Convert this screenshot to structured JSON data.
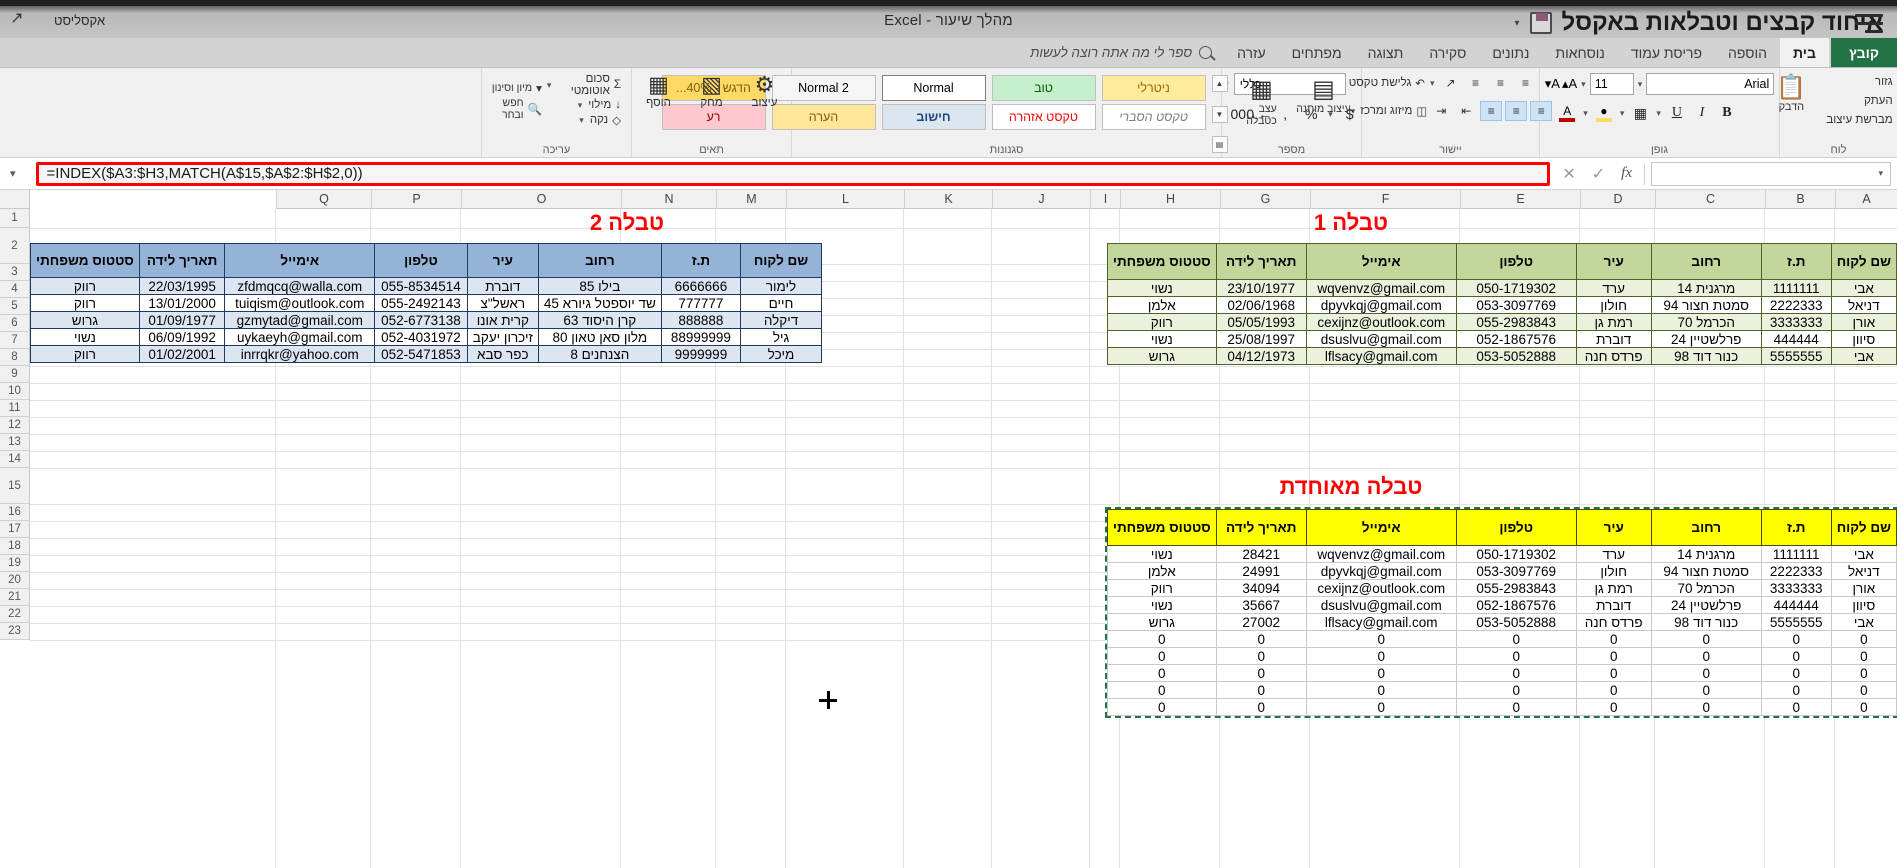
{
  "window": {
    "title": "מהלך שיעור  -  Excel",
    "account_name": "אקסליסט",
    "quick_access": [
      "save-icon",
      "undo-icon",
      "customize-icon"
    ],
    "doc_label": "איחוד קבצים וטבלאות באקסל"
  },
  "ribbon": {
    "file_tab": "קובץ",
    "tabs": [
      {
        "label": "בית",
        "active": true
      },
      {
        "label": "הוספה",
        "active": false
      },
      {
        "label": "פריסת עמוד",
        "active": false
      },
      {
        "label": "נוסחאות",
        "active": false
      },
      {
        "label": "נתונים",
        "active": false
      },
      {
        "label": "סקירה",
        "active": false
      },
      {
        "label": "תצוגה",
        "active": false
      },
      {
        "label": "מפתחים",
        "active": false
      },
      {
        "label": "עזרה",
        "active": false
      }
    ],
    "tell_me": "ספר לי מה אתה רוצה לעשות",
    "groups": {
      "clipboard": {
        "label": "לוח",
        "paste": "הדבק",
        "cut": "גזור",
        "copy": "העתק",
        "format_painter": "מברשת עיצוב"
      },
      "font": {
        "label": "גופן",
        "font_name": "Arial",
        "font_size": "11",
        "grow": "A",
        "shrink": "A",
        "bold": "B",
        "italic": "I",
        "underline": "U"
      },
      "alignment": {
        "label": "יישור",
        "wrap_text": "גלישת טקסט",
        "merge_center": "מיזוג ומרכז"
      },
      "number": {
        "label": "מספר",
        "format": "כללי",
        "percent": "%",
        "comma": ",",
        "currency": "$"
      },
      "styles": {
        "label": "סגנונות",
        "conditional_formatting": "עיצוב מותנה",
        "format_as_table": "עיצוב כטבלה",
        "cell_styles": "עצב",
        "cell_styles_sub": "כטבלה",
        "gallery": [
          {
            "name": "Normal",
            "key": "normal"
          },
          {
            "name": "Normal 2",
            "key": "normal2"
          },
          {
            "name": "הדגש - 40%...",
            "key": "accent40"
          },
          {
            "name": "טוב",
            "key": "good"
          },
          {
            "name": "ניטרלי",
            "key": "neutral"
          },
          {
            "name": "רע",
            "key": "bad"
          },
          {
            "name": "הערה",
            "key": "note"
          },
          {
            "name": "חישוב",
            "key": "calc"
          },
          {
            "name": "טקסט אזהרה",
            "key": "warning"
          },
          {
            "name": "טקסט הסברי",
            "key": "explanatory"
          }
        ]
      },
      "cells": {
        "label": "תאים",
        "insert": "הוסף",
        "delete": "מחק",
        "format": "עיצוב"
      },
      "editing": {
        "label": "עריכה",
        "autosum": "סכום אוטומטי",
        "fill": "מילוי",
        "clear": "נקה",
        "sort_filter": "מיון וסינון",
        "find_select": "חפש ובחר"
      }
    }
  },
  "formula_bar": {
    "name_box": "",
    "cancel_icon": "close-icon",
    "confirm_icon": "check-icon",
    "function_icon": "fx-icon",
    "formula": "=INDEX($A3:$H3,MATCH(A$15,$A$2:$H$2,0))",
    "expand_icon": "chevron-down-icon"
  },
  "grid": {
    "column_headers": [
      "A",
      "B",
      "C",
      "D",
      "E",
      "F",
      "G",
      "H",
      "I",
      "J",
      "K",
      "L",
      "M",
      "N",
      "O",
      "P",
      "Q"
    ],
    "row_headers": [
      "1",
      "2",
      "3",
      "4",
      "5",
      "6",
      "7",
      "8",
      "9",
      "10",
      "11",
      "12",
      "13",
      "14",
      "15",
      "16",
      "17",
      "18",
      "19",
      "20",
      "21",
      "22",
      "23"
    ]
  },
  "tables": {
    "table1": {
      "title": "טבלה 1",
      "headers": [
        "שם לקוח",
        "ת.ז",
        "רחוב",
        "עיר",
        "טלפון",
        "אימייל",
        "תאריך לידה",
        "סטטוס משפחתי"
      ],
      "rows": [
        [
          "אבי",
          "1111111",
          "מרגנית 14",
          "ערד",
          "050-1719302",
          "wqvenvz@gmail.com",
          "23/10/1977",
          "נשוי"
        ],
        [
          "דניאל",
          "2222333",
          "סמטת חצור 94",
          "חולון",
          "053-3097769",
          "dpyvkqj@gmail.com",
          "02/06/1968",
          "אלמן"
        ],
        [
          "אורן",
          "3333333",
          "הכרמל 70",
          "רמת גן",
          "055-2983843",
          "cexijnz@outlook.com",
          "05/05/1993",
          "רווק"
        ],
        [
          "סיוון",
          "444444",
          "פרלשטיין 24",
          "דוברת",
          "052-1867576",
          "dsuslvu@gmail.com",
          "25/08/1997",
          "נשוי"
        ],
        [
          "אבי",
          "5555555",
          "כנור דוד 98",
          "פרדס חנה",
          "053-5052888",
          "lflsacy@gmail.com",
          "04/12/1973",
          "גרוש"
        ]
      ]
    },
    "table2": {
      "title": "טבלה 2",
      "headers": [
        "שם לקוח",
        "ת.ז",
        "רחוב",
        "עיר",
        "טלפון",
        "אימייל",
        "תאריך לידה",
        "סטטוס משפחתי"
      ],
      "rows": [
        [
          "לימור",
          "6666666",
          "בילו 85",
          "דוברת",
          "055-8534514",
          "zfdmqcq@walla.com",
          "22/03/1995",
          "רווק"
        ],
        [
          "חיים",
          "777777",
          "שד יוספטל גיורא 45",
          "ראשל\"צ",
          "055-2492143",
          "tuiqism@outlook.com",
          "13/01/2000",
          "רווק"
        ],
        [
          "דיקלה",
          "888888",
          "קרן היסוד 63",
          "קרית אונו",
          "052-6773138",
          "gzmytad@gmail.com",
          "01/09/1977",
          "גרוש"
        ],
        [
          "גיל",
          "88999999",
          "מלון סאן טאון 80",
          "זיכרון יעקב",
          "052-4031972",
          "uykaeyh@gmail.com",
          "06/09/1992",
          "נשוי"
        ],
        [
          "מיכל",
          "9999999",
          "הצנחנים 8",
          "כפר סבא",
          "052-5471853",
          "inrrqkr@yahoo.com",
          "01/02/2001",
          "רווק"
        ]
      ]
    },
    "merged": {
      "title": "טבלה מאוחדת",
      "headers": [
        "שם לקוח",
        "ת.ז",
        "רחוב",
        "עיר",
        "טלפון",
        "אימייל",
        "תאריך לידה",
        "סטטוס משפחתי"
      ],
      "rows": [
        [
          "אבי",
          "1111111",
          "מרגנית 14",
          "ערד",
          "050-1719302",
          "wqvenvz@gmail.com",
          "28421",
          "נשוי"
        ],
        [
          "דניאל",
          "2222333",
          "סמטת חצור 94",
          "חולון",
          "053-3097769",
          "dpyvkqj@gmail.com",
          "24991",
          "אלמן"
        ],
        [
          "אורן",
          "3333333",
          "הכרמל 70",
          "רמת גן",
          "055-2983843",
          "cexijnz@outlook.com",
          "34094",
          "רווק"
        ],
        [
          "סיוון",
          "444444",
          "פרלשטיין 24",
          "דוברת",
          "052-1867576",
          "dsuslvu@gmail.com",
          "35667",
          "נשוי"
        ],
        [
          "אבי",
          "5555555",
          "כנור דוד 98",
          "פרדס חנה",
          "053-5052888",
          "lflsacy@gmail.com",
          "27002",
          "גרוש"
        ],
        [
          "0",
          "0",
          "0",
          "0",
          "0",
          "0",
          "0",
          "0"
        ],
        [
          "0",
          "0",
          "0",
          "0",
          "0",
          "0",
          "0",
          "0"
        ],
        [
          "0",
          "0",
          "0",
          "0",
          "0",
          "0",
          "0",
          "0"
        ],
        [
          "0",
          "0",
          "0",
          "0",
          "0",
          "0",
          "0",
          "0"
        ],
        [
          "0",
          "0",
          "0",
          "0",
          "0",
          "0",
          "0",
          "0"
        ]
      ]
    }
  },
  "colors": {
    "excel_green": "#217346",
    "table1_header": "#c3d69b",
    "table2_header": "#95b3d7",
    "merged_header": "#ffff00",
    "title_red": "#ff0000",
    "formula_highlight": "#ff0000"
  }
}
